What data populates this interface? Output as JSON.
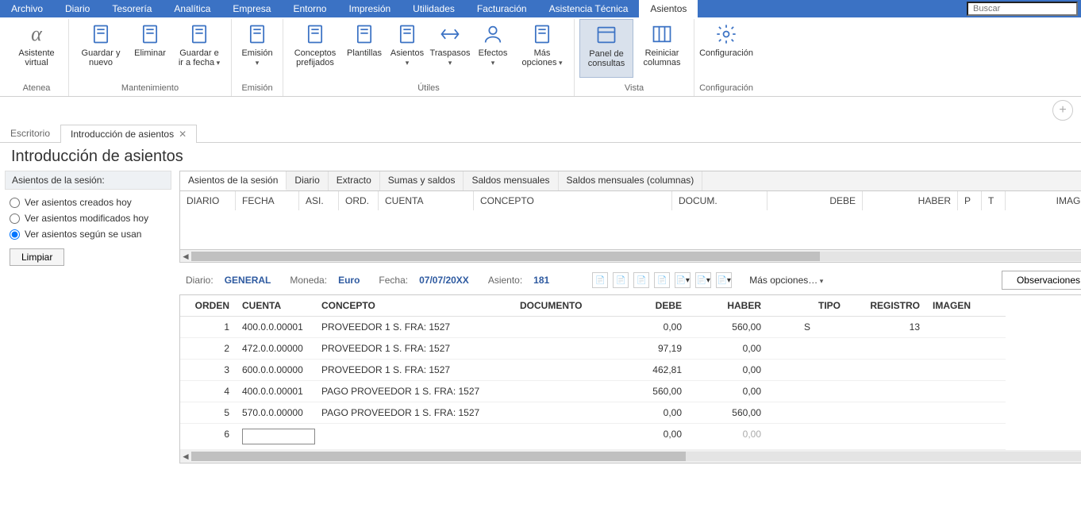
{
  "search_placeholder": "Buscar",
  "menu": [
    "Archivo",
    "Diario",
    "Tesorería",
    "Analítica",
    "Empresa",
    "Entorno",
    "Impresión",
    "Utilidades",
    "Facturación",
    "Asistencia Técnica",
    "Asientos"
  ],
  "menu_active": 10,
  "ribbon": {
    "groups": [
      {
        "label": "Atenea",
        "items": [
          {
            "label": "Asistente virtual",
            "name": "asistente-virtual",
            "icon": "alpha"
          }
        ]
      },
      {
        "label": "Mantenimiento",
        "items": [
          {
            "label": "Guardar y nuevo",
            "name": "guardar-y-nuevo",
            "icon": "doc-plus"
          },
          {
            "label": "Eliminar",
            "name": "eliminar",
            "icon": "doc-x"
          },
          {
            "label": "Guardar e ir a fecha",
            "name": "guardar-ir-fecha",
            "icon": "doc-arrow",
            "dropdown": true
          }
        ]
      },
      {
        "label": "Emisión",
        "items": [
          {
            "label": "Emisión",
            "name": "emision",
            "icon": "doc-edit",
            "dropdown": true
          }
        ]
      },
      {
        "label": "Útiles",
        "items": [
          {
            "label": "Conceptos prefijados",
            "name": "conceptos-prefijados",
            "icon": "doc-list"
          },
          {
            "label": "Plantillas",
            "name": "plantillas",
            "icon": "doc-plus2"
          },
          {
            "label": "Asientos",
            "name": "asientos-util",
            "icon": "doc-edit2",
            "dropdown": true
          },
          {
            "label": "Traspasos",
            "name": "traspasos",
            "icon": "arrows",
            "dropdown": true
          },
          {
            "label": "Efectos",
            "name": "efectos",
            "icon": "person",
            "dropdown": true
          },
          {
            "label": "Más opciones",
            "name": "mas-opciones",
            "icon": "doc-more",
            "dropdown": true
          }
        ]
      },
      {
        "label": "Vista",
        "items": [
          {
            "label": "Panel de consultas",
            "name": "panel-consultas",
            "icon": "panel",
            "active": true
          },
          {
            "label": "Reiniciar columnas",
            "name": "reiniciar-columnas",
            "icon": "columns"
          }
        ]
      },
      {
        "label": "Configuración",
        "items": [
          {
            "label": "Configuración",
            "name": "configuracion",
            "icon": "gear"
          }
        ]
      }
    ]
  },
  "doc_tabs": [
    {
      "label": "Escritorio",
      "closable": false,
      "active": false
    },
    {
      "label": "Introducción de asientos",
      "closable": true,
      "active": true
    }
  ],
  "page_title": "Introducción de asientos",
  "sidebar": {
    "header": "Asientos de la sesión:",
    "radios": [
      {
        "label": "Ver asientos creados hoy",
        "checked": false
      },
      {
        "label": "Ver asientos modificados hoy",
        "checked": false
      },
      {
        "label": "Ver asientos según se usan",
        "checked": true
      }
    ],
    "clear_btn": "Limpiar"
  },
  "inner_tabs": [
    "Asientos de la sesión",
    "Diario",
    "Extracto",
    "Sumas y saldos",
    "Saldos mensuales",
    "Saldos mensuales (columnas)"
  ],
  "inner_tab_active": 0,
  "grid_headers": [
    "DIARIO",
    "FECHA",
    "ASI.",
    "ORD.",
    "CUENTA",
    "CONCEPTO",
    "DOCUM.",
    "DEBE",
    "HABER",
    "P",
    "T",
    "IMAGEN"
  ],
  "info": {
    "diario_lbl": "Diario:",
    "diario_val": "GENERAL",
    "moneda_lbl": "Moneda:",
    "moneda_val": "Euro",
    "fecha_lbl": "Fecha:",
    "fecha_val": "07/07/20XX",
    "asiento_lbl": "Asiento:",
    "asiento_val": "181",
    "more_opts": "Más opciones…",
    "obs_btn": "Observaciones"
  },
  "btable": {
    "headers": [
      "ORDEN",
      "CUENTA",
      "CONCEPTO",
      "DOCUMENTO",
      "DEBE",
      "HABER",
      "TIPO",
      "REGISTRO",
      "IMAGEN"
    ],
    "rows": [
      {
        "orden": "1",
        "cuenta": "400.0.0.00001",
        "concepto": "PROVEEDOR 1 S. FRA:  1527",
        "documento": "",
        "debe": "0,00",
        "haber": "560,00",
        "tipo": "S",
        "registro": "13",
        "imagen": ""
      },
      {
        "orden": "2",
        "cuenta": "472.0.0.00000",
        "concepto": "PROVEEDOR 1 S. FRA:  1527",
        "documento": "",
        "debe": "97,19",
        "haber": "0,00",
        "tipo": "",
        "registro": "",
        "imagen": ""
      },
      {
        "orden": "3",
        "cuenta": "600.0.0.00000",
        "concepto": "PROVEEDOR 1 S. FRA:  1527",
        "documento": "",
        "debe": "462,81",
        "haber": "0,00",
        "tipo": "",
        "registro": "",
        "imagen": ""
      },
      {
        "orden": "4",
        "cuenta": "400.0.0.00001",
        "concepto": "PAGO PROVEEDOR 1 S. FRA:  1527",
        "documento": "",
        "debe": "560,00",
        "haber": "0,00",
        "tipo": "",
        "registro": "",
        "imagen": ""
      },
      {
        "orden": "5",
        "cuenta": "570.0.0.00000",
        "concepto": "PAGO PROVEEDOR 1 S. FRA:  1527",
        "documento": "",
        "debe": "0,00",
        "haber": "560,00",
        "tipo": "",
        "registro": "",
        "imagen": ""
      },
      {
        "orden": "6",
        "cuenta": "",
        "concepto": "",
        "documento": "",
        "debe": "0,00",
        "haber": "0,00",
        "tipo": "",
        "registro": "",
        "imagen": "",
        "editing": true,
        "haber_grey": true
      }
    ]
  }
}
